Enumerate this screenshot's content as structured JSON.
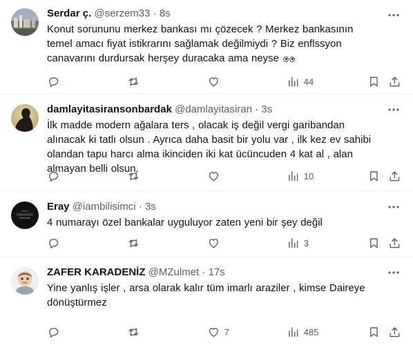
{
  "tweets": [
    {
      "name": "Serdar ç.",
      "handle": "@serzem33",
      "sep": "·",
      "time": "8s",
      "text": "Konut sorununu merkez bankası mı çözecek ? Merkez bankasının temel amacı fiyat istikrarını sağlamak değilmiydi ? Biz enflssyon canavarını durdursak herşey duracaka ama neyse",
      "emoji": "eyes-emoji",
      "replies": "",
      "retweets": "",
      "likes": "",
      "views": "44"
    },
    {
      "name": "damlayitasiransonbardak",
      "handle": "@damlayitasiran",
      "sep": "·",
      "time": "3s",
      "text": "İlk madde modern ağalara ters , olacak iş değil vergi garibandan alınacak ki tatlı olsun . Ayrıca daha basit bir yolu var , ilk kez ev sahibi olandan tapu harcı alma ikinciden iki kat ücüncuden 4 kat al , alan almayan belli olsun.",
      "replies": "",
      "retweets": "",
      "likes": "",
      "views": "10"
    },
    {
      "name": "Eray",
      "handle": "@iambilisimci",
      "sep": "·",
      "time": "3s",
      "text": "4 numarayı özel bankalar uyguluyor zaten yeni bir şey değil",
      "replies": "",
      "retweets": "",
      "likes": "",
      "views": "3"
    },
    {
      "name": "ZAFER KARADENİZ",
      "handle": "@MZulmet",
      "sep": "·",
      "time": "17s",
      "text": "Yine yanlış işler , arsa olarak kalır tüm imarlı araziler , kimse Daireye dönüştürmez",
      "replies": "",
      "retweets": "",
      "likes": "7",
      "views": "485"
    }
  ],
  "icons": {
    "reply": "reply-icon",
    "retweet": "retweet-icon",
    "like": "heart-icon",
    "views": "views-icon",
    "bookmark": "bookmark-icon",
    "share": "share-icon",
    "more": "more-icon"
  }
}
